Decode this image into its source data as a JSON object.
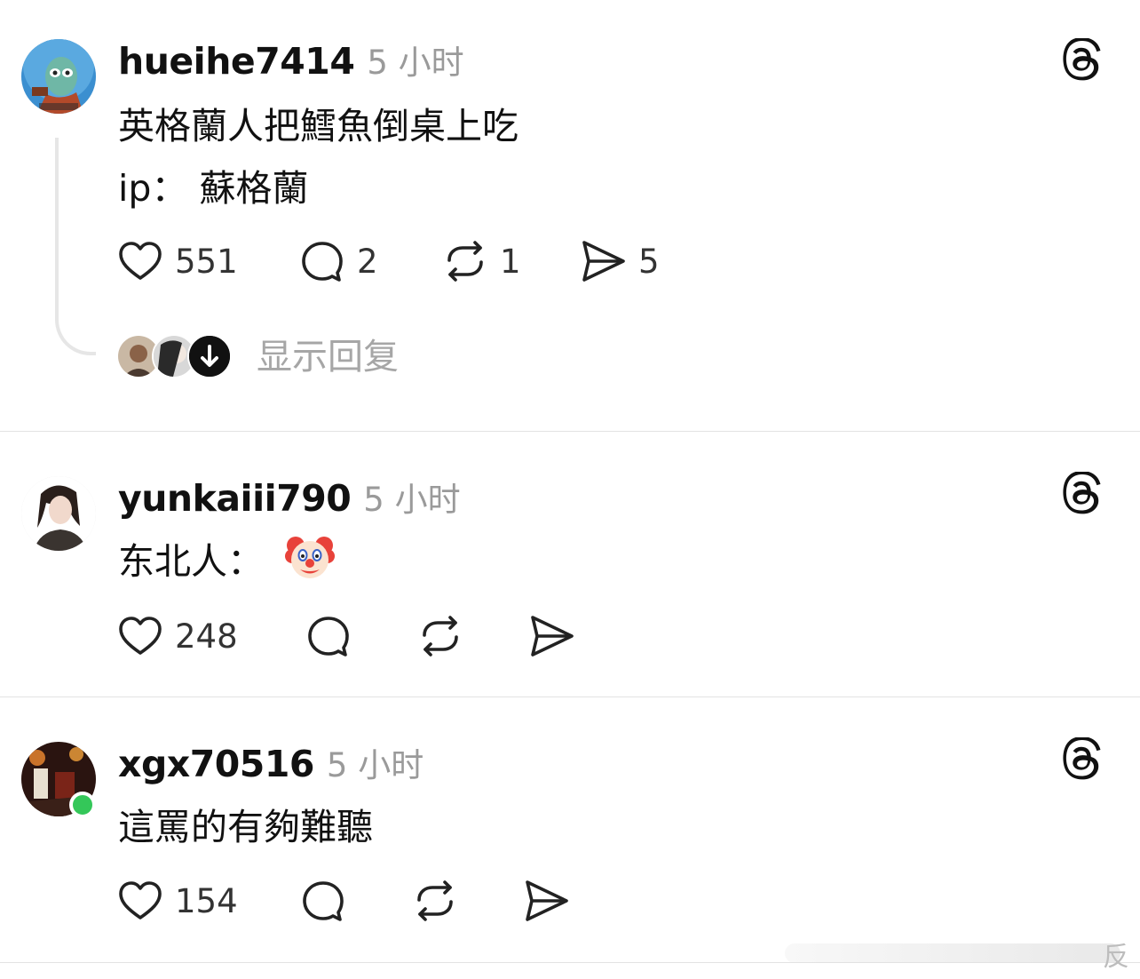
{
  "posts": [
    {
      "username": "hueihe7414",
      "time": "5 小时",
      "lines": [
        "英格蘭人把鱈魚倒桌上吃",
        "ip： 蘇格蘭"
      ],
      "counts": {
        "like": "551",
        "comment": "2",
        "repost": "1",
        "share": "5"
      }
    },
    {
      "username": "yunkaiii790",
      "time": "5 小时",
      "lines": [
        "东北人："
      ],
      "counts": {
        "like": "248",
        "comment": "",
        "repost": "",
        "share": ""
      }
    },
    {
      "username": "xgx70516",
      "time": "5 小时",
      "lines": [
        "這罵的有夠難聽"
      ],
      "counts": {
        "like": "154",
        "comment": "",
        "repost": "",
        "share": ""
      }
    }
  ],
  "replies": {
    "label": "显示回复"
  },
  "watermark": {
    "text": "反"
  },
  "colors": {
    "online": "#34c759",
    "divider": "#e3e3e3",
    "muted": "#9a9a9a"
  }
}
